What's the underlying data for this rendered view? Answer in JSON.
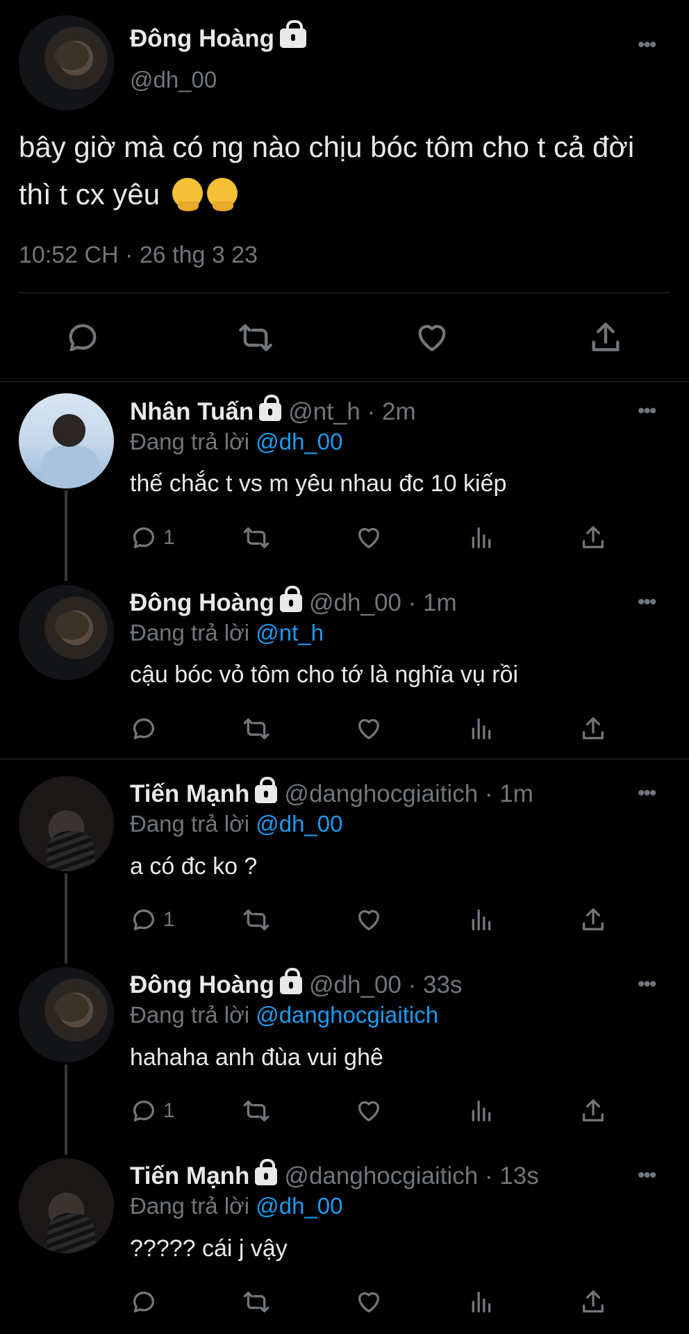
{
  "main_tweet": {
    "name": "Đông Hoàng",
    "handle": "@dh_00",
    "text": "bây giờ mà có ng nào chịu bóc tôm cho t cả đời thì t cx yêu",
    "emoji_icons": [
      "melting-face-emoji",
      "melting-face-emoji"
    ],
    "timestamp": "10:52 CH · 26 thg 3 23",
    "actions": [
      "reply-icon",
      "retweet-icon",
      "like-icon",
      "share-icon"
    ]
  },
  "reply_prefix": "Đang trả lời",
  "replies": [
    {
      "name": "Nhân Tuấn",
      "meta": "@nt_h · 2m",
      "reply_to": "@dh_00",
      "text": "thế chắc t vs m yêu nhau đc 10 kiếp",
      "reply_count": "1"
    },
    {
      "name": "Đông Hoàng",
      "meta": "@dh_00 · 1m",
      "reply_to": "@nt_h",
      "text": "cậu bóc vỏ tôm cho tớ là nghĩa vụ rồi",
      "reply_count": ""
    },
    {
      "name": "Tiến Mạnh",
      "meta": "@danghocgiaitich · 1m",
      "reply_to": "@dh_00",
      "text": "a có đc ko ?",
      "reply_count": "1"
    },
    {
      "name": "Đông Hoàng",
      "meta": "@dh_00 · 33s",
      "reply_to": "@danghocgiaitich",
      "text": "hahaha anh đùa vui ghê",
      "reply_count": "1"
    },
    {
      "name": "Tiến Mạnh",
      "meta": "@danghocgiaitich · 13s",
      "reply_to": "@dh_00",
      "text": "????? cái j vậy",
      "reply_count": ""
    }
  ],
  "more_icon": "•••",
  "colors": {
    "background": "#000000",
    "text": "#e7e9ea",
    "muted": "#71767b",
    "link": "#1d9bf0",
    "divider": "#2f3336"
  }
}
